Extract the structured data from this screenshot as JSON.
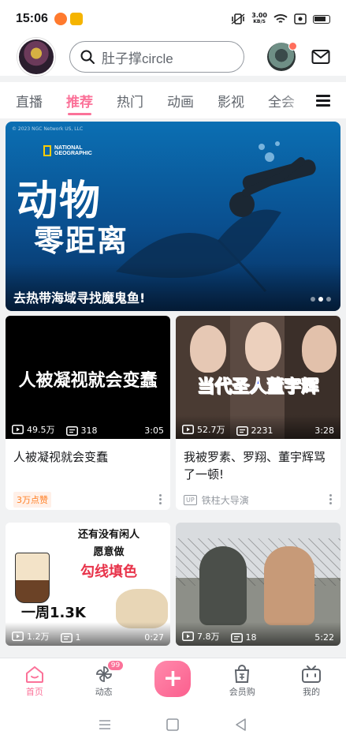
{
  "status_bar": {
    "time": "15:06",
    "net_speed_value": "3.00",
    "net_speed_unit": "KB/S"
  },
  "header": {
    "search_placeholder": "肚子撑circle"
  },
  "tabs": [
    {
      "label": "直播",
      "active": false
    },
    {
      "label": "推荐",
      "active": true
    },
    {
      "label": "热门",
      "active": false
    },
    {
      "label": "动画",
      "active": false
    },
    {
      "label": "影视",
      "active": false
    },
    {
      "label": "全会",
      "active": false
    }
  ],
  "banner": {
    "copyright": "© 2023 NGC Network US, LLC",
    "brand_line1": "NATIONAL",
    "brand_line2": "GEOGRAPHIC",
    "title_line1": "动物",
    "title_line2": "零距离",
    "caption": "去热带海域寻找魔鬼鱼!"
  },
  "cards": [
    {
      "thumb_text": "人被凝视就会变蠢",
      "views": "49.5万",
      "danmaku": "318",
      "duration": "3:05",
      "title": "人被凝视就会变蠢",
      "badge": "3万点赞"
    },
    {
      "thumb_text": "当代圣人董宇辉",
      "views": "52.7万",
      "danmaku": "2231",
      "duration": "3:28",
      "title": "我被罗素、罗翔、董宇辉骂了一顿!",
      "uploader": "铁柱大导演",
      "up_tag": "UP"
    },
    {
      "thumb_line1": "还有没有闲人",
      "thumb_line2": "愿意做",
      "thumb_line3": "勾线填色",
      "thumb_line4": "一周1.3K",
      "views": "1.2万",
      "danmaku": "1",
      "duration": "0:27"
    },
    {
      "views": "7.8万",
      "danmaku": "18",
      "duration": "5:22"
    }
  ],
  "bottom_nav": {
    "home": "首页",
    "dynamic": "动态",
    "dynamic_badge": "99",
    "publish": "+",
    "vip_shop": "会员购",
    "mine": "我的"
  },
  "colors": {
    "accent": "#fb7299",
    "badge_orange": "#ff7f24"
  }
}
